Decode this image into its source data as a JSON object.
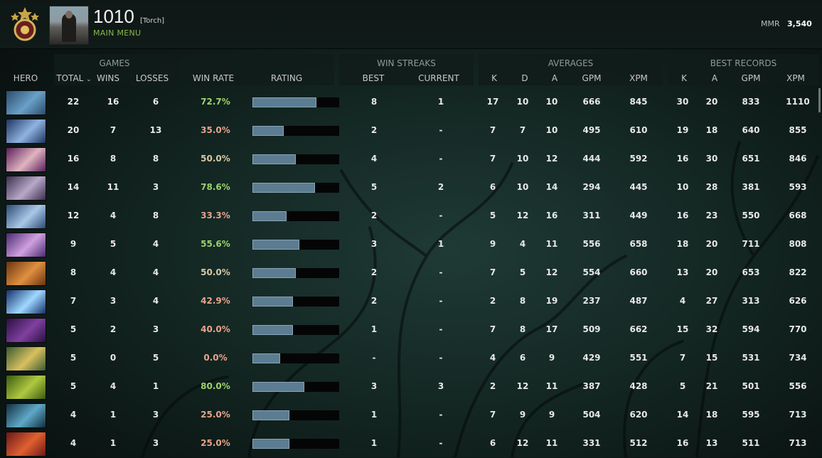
{
  "header": {
    "player_name": "1010",
    "player_tag": "[Torch]",
    "menu_link": "MAIN MENU",
    "mmr_label": "MMR",
    "mmr_value": "3,540"
  },
  "groups": {
    "games": "GAMES",
    "win_streaks": "WIN STREAKS",
    "averages": "AVERAGES",
    "best_records": "BEST RECORDS"
  },
  "columns": {
    "hero": "HERO",
    "total": "TOTAL",
    "wins": "WINS",
    "losses": "LOSSES",
    "win_rate": "WIN RATE",
    "rating": "RATING",
    "streak_best": "BEST",
    "streak_current": "CURRENT",
    "avg_k": "K",
    "avg_d": "D",
    "avg_a": "A",
    "avg_gpm": "GPM",
    "avg_xpm": "XPM",
    "best_k": "K",
    "best_a": "A",
    "best_gpm": "GPM",
    "best_xpm": "XPM"
  },
  "colors": {
    "win_green": "#9cd36b",
    "win_neutral": "#d7c9a6",
    "win_red": "#e8a38c",
    "accent_green": "#86b845",
    "bar_fill": "#5c7c91"
  },
  "rows": [
    {
      "hero_icon": "hero-portrait-icon",
      "c1": "#2b4c6b",
      "c2": "#6aa0c8",
      "total": "22",
      "wins": "16",
      "losses": "6",
      "win_rate": "72.7%",
      "rating": 0.74,
      "best": "8",
      "current": "1",
      "k": "17",
      "d": "10",
      "a": "10",
      "gpm": "666",
      "xpm": "845",
      "bk": "30",
      "ba": "20",
      "bgpm": "833",
      "bxpm": "1110"
    },
    {
      "hero_icon": "hero-portrait-icon",
      "c1": "#1e3560",
      "c2": "#8fb3e0",
      "total": "20",
      "wins": "7",
      "losses": "13",
      "win_rate": "35.0%",
      "rating": 0.36,
      "best": "2",
      "current": "-",
      "k": "7",
      "d": "7",
      "a": "10",
      "gpm": "495",
      "xpm": "610",
      "bk": "19",
      "ba": "18",
      "bgpm": "640",
      "bxpm": "855"
    },
    {
      "hero_icon": "hero-portrait-icon",
      "c1": "#5a1e5a",
      "c2": "#e0b4c0",
      "total": "16",
      "wins": "8",
      "losses": "8",
      "win_rate": "50.0%",
      "rating": 0.5,
      "best": "4",
      "current": "-",
      "k": "7",
      "d": "10",
      "a": "12",
      "gpm": "444",
      "xpm": "592",
      "bk": "16",
      "ba": "30",
      "bgpm": "651",
      "bxpm": "846"
    },
    {
      "hero_icon": "hero-portrait-icon",
      "c1": "#3c2f4e",
      "c2": "#b9a8c8",
      "total": "14",
      "wins": "11",
      "losses": "3",
      "win_rate": "78.6%",
      "rating": 0.72,
      "best": "5",
      "current": "2",
      "k": "6",
      "d": "10",
      "a": "14",
      "gpm": "294",
      "xpm": "445",
      "bk": "10",
      "ba": "28",
      "bgpm": "381",
      "bxpm": "593"
    },
    {
      "hero_icon": "hero-portrait-icon",
      "c1": "#2a4a73",
      "c2": "#a9c8e8",
      "total": "12",
      "wins": "4",
      "losses": "8",
      "win_rate": "33.3%",
      "rating": 0.39,
      "best": "2",
      "current": "-",
      "k": "5",
      "d": "12",
      "a": "16",
      "gpm": "311",
      "xpm": "449",
      "bk": "16",
      "ba": "23",
      "bgpm": "550",
      "bxpm": "668"
    },
    {
      "hero_icon": "hero-portrait-icon",
      "c1": "#4a2a70",
      "c2": "#d0a0e0",
      "total": "9",
      "wins": "5",
      "losses": "4",
      "win_rate": "55.6%",
      "rating": 0.54,
      "best": "3",
      "current": "1",
      "k": "9",
      "d": "4",
      "a": "11",
      "gpm": "556",
      "xpm": "658",
      "bk": "18",
      "ba": "20",
      "bgpm": "711",
      "bxpm": "808"
    },
    {
      "hero_icon": "hero-portrait-icon",
      "c1": "#6a3410",
      "c2": "#e09040",
      "total": "8",
      "wins": "4",
      "losses": "4",
      "win_rate": "50.0%",
      "rating": 0.5,
      "best": "2",
      "current": "-",
      "k": "7",
      "d": "5",
      "a": "12",
      "gpm": "554",
      "xpm": "660",
      "bk": "13",
      "ba": "20",
      "bgpm": "653",
      "bxpm": "822"
    },
    {
      "hero_icon": "hero-portrait-icon",
      "c1": "#15306a",
      "c2": "#9fd8ff",
      "total": "7",
      "wins": "3",
      "losses": "4",
      "win_rate": "42.9%",
      "rating": 0.47,
      "best": "2",
      "current": "-",
      "k": "2",
      "d": "8",
      "a": "19",
      "gpm": "237",
      "xpm": "487",
      "bk": "4",
      "ba": "27",
      "bgpm": "313",
      "bxpm": "626"
    },
    {
      "hero_icon": "hero-portrait-icon",
      "c1": "#2a1040",
      "c2": "#8040a0",
      "total": "5",
      "wins": "2",
      "losses": "3",
      "win_rate": "40.0%",
      "rating": 0.47,
      "best": "1",
      "current": "-",
      "k": "7",
      "d": "8",
      "a": "17",
      "gpm": "509",
      "xpm": "662",
      "bk": "15",
      "ba": "32",
      "bgpm": "594",
      "bxpm": "770"
    },
    {
      "hero_icon": "hero-portrait-icon",
      "c1": "#3a5a30",
      "c2": "#d8c060",
      "total": "5",
      "wins": "0",
      "losses": "5",
      "win_rate": "0.0%",
      "rating": 0.32,
      "best": "-",
      "current": "-",
      "k": "4",
      "d": "6",
      "a": "9",
      "gpm": "429",
      "xpm": "551",
      "bk": "7",
      "ba": "15",
      "bgpm": "531",
      "bxpm": "734"
    },
    {
      "hero_icon": "hero-portrait-icon",
      "c1": "#3a5a10",
      "c2": "#b0c840",
      "total": "5",
      "wins": "4",
      "losses": "1",
      "win_rate": "80.0%",
      "rating": 0.6,
      "best": "3",
      "current": "3",
      "k": "2",
      "d": "12",
      "a": "11",
      "gpm": "387",
      "xpm": "428",
      "bk": "5",
      "ba": "21",
      "bgpm": "501",
      "bxpm": "556"
    },
    {
      "hero_icon": "hero-portrait-icon",
      "c1": "#103040",
      "c2": "#60a8c8",
      "total": "4",
      "wins": "1",
      "losses": "3",
      "win_rate": "25.0%",
      "rating": 0.43,
      "best": "1",
      "current": "-",
      "k": "7",
      "d": "9",
      "a": "9",
      "gpm": "504",
      "xpm": "620",
      "bk": "14",
      "ba": "18",
      "bgpm": "595",
      "bxpm": "713"
    },
    {
      "hero_icon": "hero-portrait-icon",
      "c1": "#6a1818",
      "c2": "#e06030",
      "total": "4",
      "wins": "1",
      "losses": "3",
      "win_rate": "25.0%",
      "rating": 0.43,
      "best": "1",
      "current": "-",
      "k": "6",
      "d": "12",
      "a": "11",
      "gpm": "331",
      "xpm": "512",
      "bk": "16",
      "ba": "13",
      "bgpm": "511",
      "bxpm": "713"
    }
  ]
}
